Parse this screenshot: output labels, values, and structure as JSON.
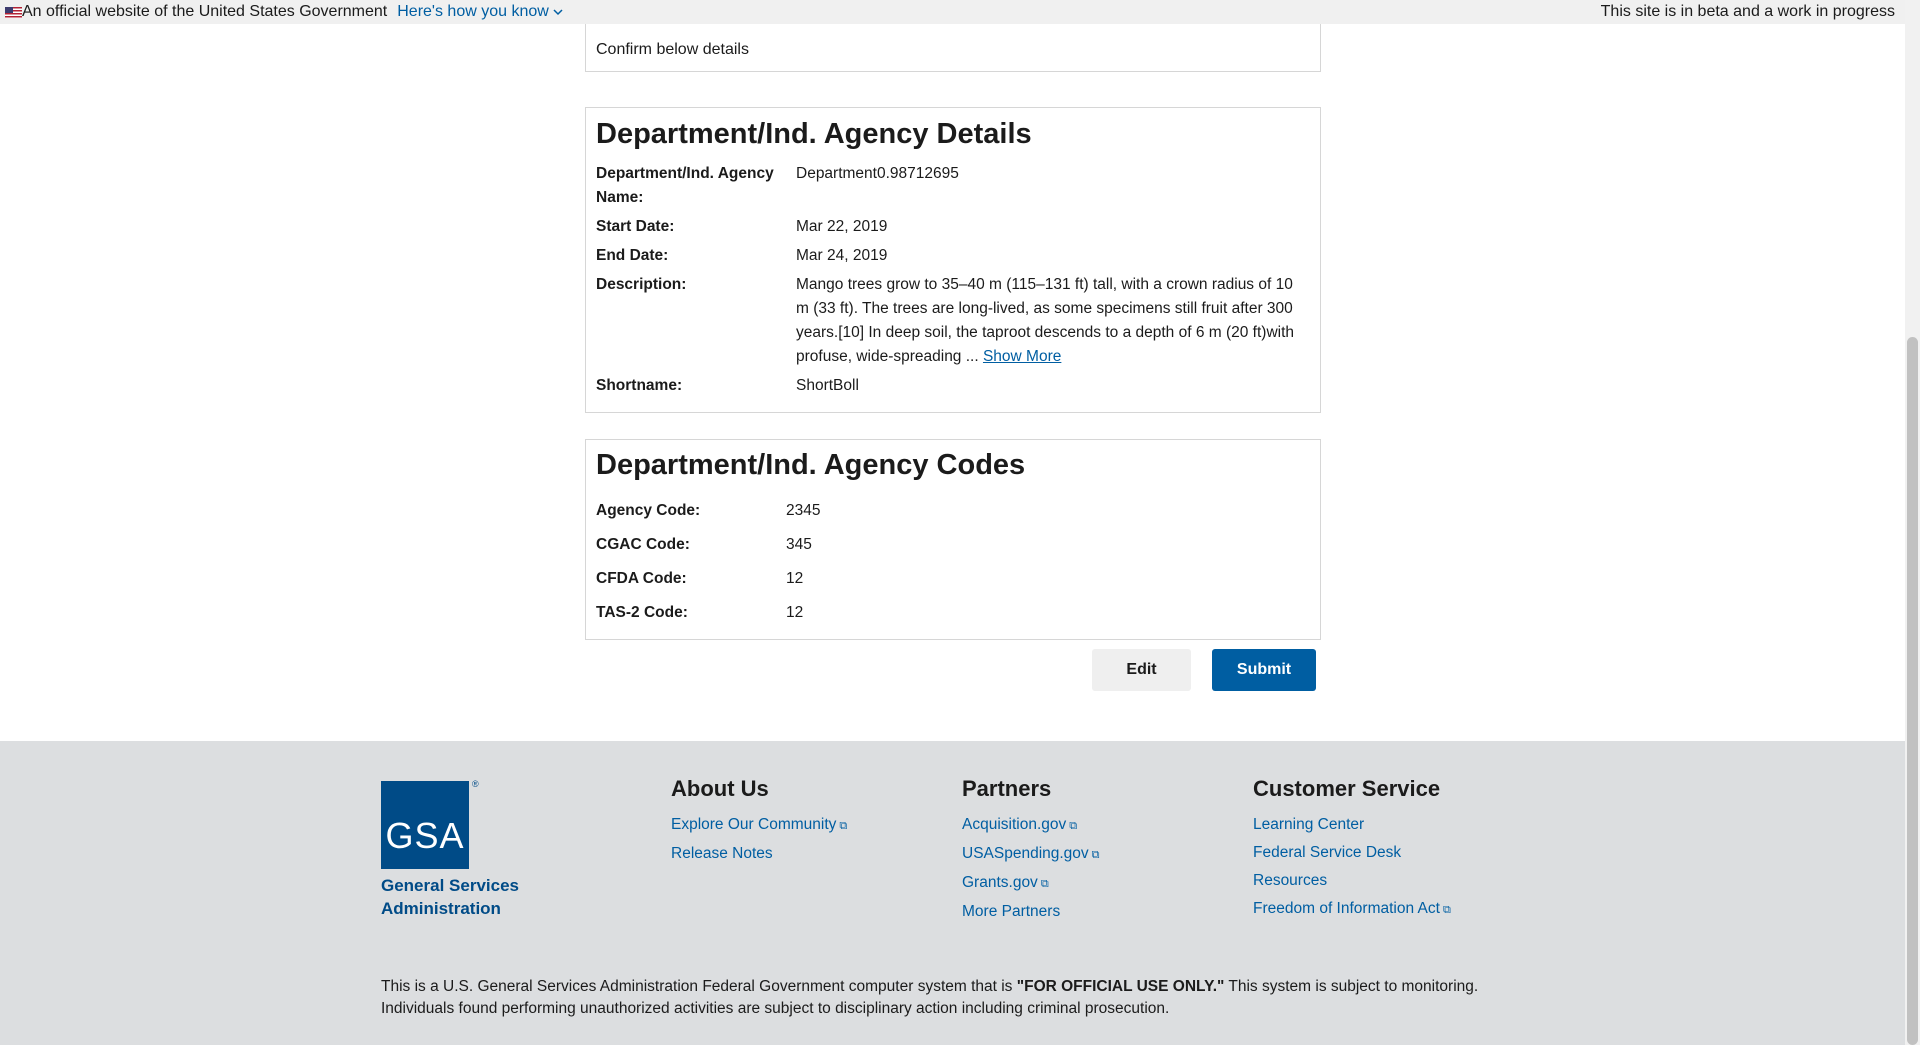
{
  "banner": {
    "official_text": "An official website of the United States Government",
    "how_you_know": "Here's how you know",
    "beta_text": "This site is in beta and a work in progress"
  },
  "confirm": {
    "text": "Confirm below details"
  },
  "details": {
    "title": "Department/Ind. Agency Details",
    "name_label": "Department/Ind. Agency Name:",
    "name_value": "Department0.98712695",
    "start_label": "Start Date:",
    "start_value": "Mar 22, 2019",
    "end_label": "End Date:",
    "end_value": "Mar 24, 2019",
    "desc_label": "Description:",
    "desc_value": "Mango trees grow to 35–40 m (115–131 ft) tall, with a crown radius of 10 m (33 ft). The trees are long-lived, as some specimens still fruit after 300 years.[10] In deep soil, the taproot descends to a depth of 6 m (20 ft)with profuse, wide-spreading ...",
    "show_more": "Show More",
    "shortname_label": "Shortname:",
    "shortname_value": "ShortBoll"
  },
  "codes": {
    "title": "Department/Ind. Agency Codes",
    "agency_label": "Agency Code:",
    "agency_value": "2345",
    "cgac_label": "CGAC Code:",
    "cgac_value": "345",
    "cfda_label": "CFDA Code:",
    "cfda_value": "12",
    "tas_label": "TAS-2 Code:",
    "tas_value": "12"
  },
  "actions": {
    "edit": "Edit",
    "submit": "Submit"
  },
  "footer": {
    "logo_text": "GSA",
    "logo_caption": "General Services Administration",
    "about_title": "About Us",
    "about_links": [
      "Explore Our Community",
      "Release Notes"
    ],
    "partners_title": "Partners",
    "partners_links": [
      "Acquisition.gov",
      "USASpending.gov",
      "Grants.gov",
      "More Partners"
    ],
    "service_title": "Customer Service",
    "service_links": [
      "Learning Center",
      "Federal Service Desk",
      "Resources",
      "Freedom of Information Act"
    ],
    "disclaimer_pre": "This is a U.S. General Services Administration Federal Government computer system that is ",
    "disclaimer_bold": "\"FOR OFFICIAL USE ONLY.\"",
    "disclaimer_post": " This system is subject to monitoring. Individuals found performing unauthorized activities are subject to disciplinary action including criminal prosecution."
  },
  "colors": {
    "link": "#005ea2",
    "primary_button": "#005ea2",
    "footer_bg": "#dcdee0",
    "gsa_blue": "#004b87"
  },
  "icons": [
    "us-flag-icon",
    "chevron-down-icon",
    "external-link-icon"
  ]
}
